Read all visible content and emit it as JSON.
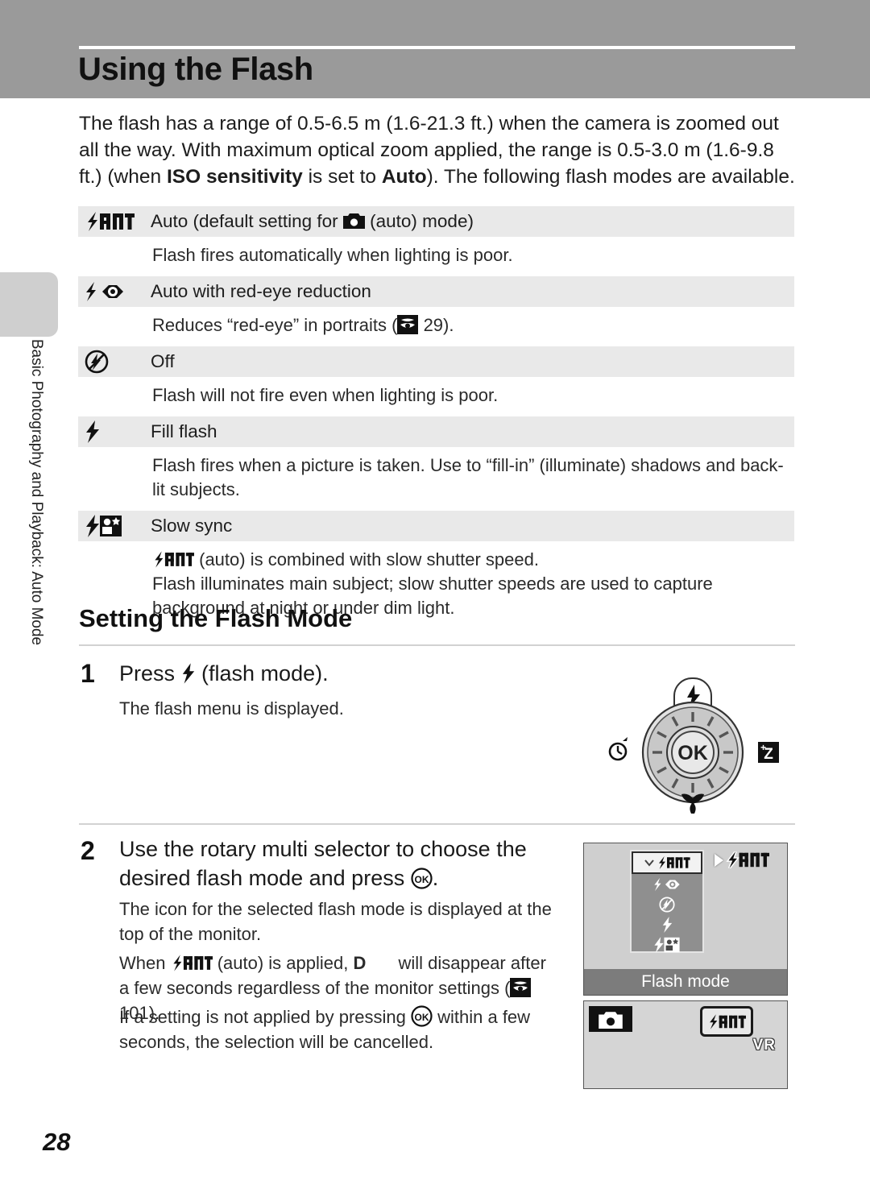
{
  "page": {
    "title": "Using the Flash",
    "number": "28",
    "side_tab_label": "Basic Photography and Playback: Auto Mode"
  },
  "intro": {
    "part1": "The flash has a range of 0.5-6.5 m (1.6-21.3 ft.) when the camera is zoomed out all the way. With maximum optical zoom applied, the range is 0.5-3.0 m (1.6-9.8 ft.) (when ",
    "bold1": "ISO sensitivity",
    "part2": " is set to ",
    "bold2": "Auto",
    "part3": "). The following flash modes are available."
  },
  "flash_modes": [
    {
      "icon": "flash-auto-icon",
      "label_pre": "Auto (default setting for ",
      "label_post": " (auto) mode)",
      "inline_icon": "camera-auto-mode-icon",
      "description": "Flash fires automatically when lighting is poor."
    },
    {
      "icon": "flash-redeye-icon",
      "label_pre": "Auto with red-eye reduction",
      "label_post": "",
      "inline_icon": "",
      "description_pre": "Reduces “red-eye” in portraits (",
      "ref_icon": "book-reference-icon",
      "ref_page": " 29).",
      "description": "Reduces “red-eye” in portraits ( 29)."
    },
    {
      "icon": "flash-off-icon",
      "label_pre": "Off",
      "label_post": "",
      "inline_icon": "",
      "description": "Flash will not fire even when lighting is poor."
    },
    {
      "icon": "flash-fill-icon",
      "label_pre": "Fill flash",
      "label_post": "",
      "inline_icon": "",
      "description": "Flash fires when a picture is taken. Use to “fill-in” (illuminate) shadows and back-lit subjects."
    },
    {
      "icon": "flash-slowsync-icon",
      "label_pre": "Slow sync",
      "label_post": "",
      "inline_icon": "",
      "description_line1_post": " (auto) is combined with slow shutter speed.",
      "description_line2": "Flash illuminates main subject; slow shutter speeds are used to capture background at night or under dim light.",
      "description": "(auto) is combined with slow shutter speed. Flash illuminates main subject; slow shutter speeds are used to capture background at night or under dim light."
    }
  ],
  "section": {
    "heading": "Setting the Flash Mode"
  },
  "steps": [
    {
      "number": "1",
      "title_pre": "Press ",
      "title_post": " (flash mode).",
      "body": "The flash menu is displayed."
    },
    {
      "number": "2",
      "title_pre": "Use the rotary multi selector to choose the desired flash mode and press ",
      "title_post": ".",
      "body1": "The icon for the selected flash mode is displayed at the top of the monitor.",
      "body2_pre": "When ",
      "body2_mid": " (auto) is applied, ",
      "body2_mid2": "D",
      "body2_mid3": " will disappear after a few seconds regardless of the monitor settings (",
      "body2_page": " 101).",
      "body3_pre": "If a setting is not applied by pressing ",
      "body3_post": " within a few seconds, the selection will be cancelled."
    }
  ],
  "dial": {
    "center_label": "OK",
    "top_icon": "flash-button-icon",
    "left_icon": "self-timer-icon",
    "right_icon": "exposure-compensation-icon",
    "bottom_icon": "macro-mode-icon"
  },
  "monitor_menu": {
    "caption": "Flash mode",
    "selected_index": 0,
    "items": [
      "flash-auto-icon",
      "flash-redeye-icon",
      "flash-off-icon",
      "flash-fill-icon",
      "flash-slowsync-icon"
    ],
    "callout_icon": "flash-auto-icon"
  },
  "monitor_shot": {
    "mode_icon": "camera-auto-mode-icon",
    "flash_badge_icon": "flash-auto-icon",
    "vr_label": "VR"
  }
}
